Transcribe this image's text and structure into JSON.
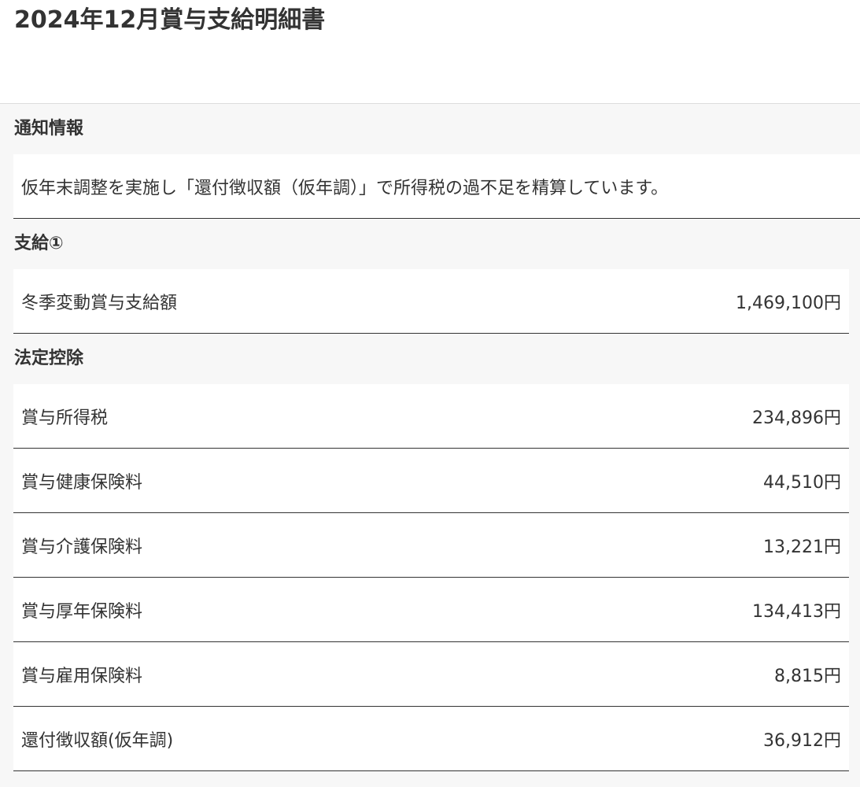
{
  "page": {
    "title": "2024年12月賞与支給明細書"
  },
  "notice": {
    "heading": "通知情報",
    "text": "仮年末調整を実施し「還付徴収額（仮年調）」で所得税の過不足を精算しています。"
  },
  "payments": {
    "heading": "支給①",
    "rows": [
      {
        "label": "冬季変動賞与支給額",
        "value": "1,469,100円"
      }
    ]
  },
  "deductions": {
    "heading": "法定控除",
    "rows": [
      {
        "label": "賞与所得税",
        "value": "234,896円"
      },
      {
        "label": "賞与健康保険料",
        "value": "44,510円"
      },
      {
        "label": "賞与介護保険料",
        "value": "13,221円"
      },
      {
        "label": "賞与厚年保険料",
        "value": "134,413円"
      },
      {
        "label": "賞与雇用保険料",
        "value": "8,815円"
      },
      {
        "label": "還付徴収額(仮年調)",
        "value": "36,912円"
      }
    ]
  }
}
